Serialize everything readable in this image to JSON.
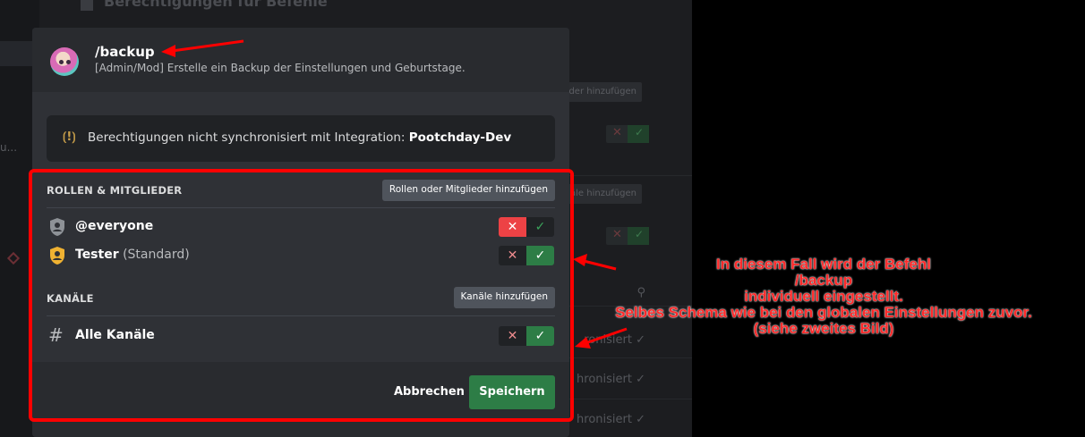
{
  "command": {
    "name": "/backup",
    "description": "[Admin/Mod] Erstelle ein Backup der Einstellungen und Geburtstage."
  },
  "sync_notice": {
    "prefix": "Berechtigungen nicht synchronisiert mit Integration: ",
    "integration": "Pootchday-Dev"
  },
  "roles_section": {
    "heading": "ROLLEN & MITGLIEDER",
    "add_button": "Rollen oder Mitglieder hinzufügen",
    "rows": [
      {
        "label": "@everyone",
        "suffix": "",
        "state": "deny"
      },
      {
        "label": "Tester",
        "suffix": " (Standard)",
        "state": "allow"
      }
    ]
  },
  "channels_section": {
    "heading": "KANÄLE",
    "add_button": "Kanäle hinzufügen",
    "rows": [
      {
        "label": "Alle Kanäle",
        "state": "allow"
      }
    ]
  },
  "footer": {
    "cancel": "Abbrechen",
    "save": "Speichern"
  },
  "annotation": {
    "lines": [
      "In diesem Fall wird der Befehl",
      "/backup",
      "individuell eingestellt.",
      "Selbes Schema wie bei den globalen Einstellungen zuvor.",
      "(siehe zweites Bild)"
    ],
    "color": "#ff0000"
  },
  "background": {
    "title": "Berechtigungen für Befehle",
    "buttons": [
      "lieder hinzufügen",
      "äle hinzufügen"
    ],
    "rows": [
      "ronisiert",
      "hronisiert",
      "hronisiert"
    ]
  },
  "colors": {
    "deny_active": "#ed4245",
    "allow_active": "#2d7d46",
    "save_button": "#2d7d46",
    "modal_bg": "#2f3136"
  }
}
